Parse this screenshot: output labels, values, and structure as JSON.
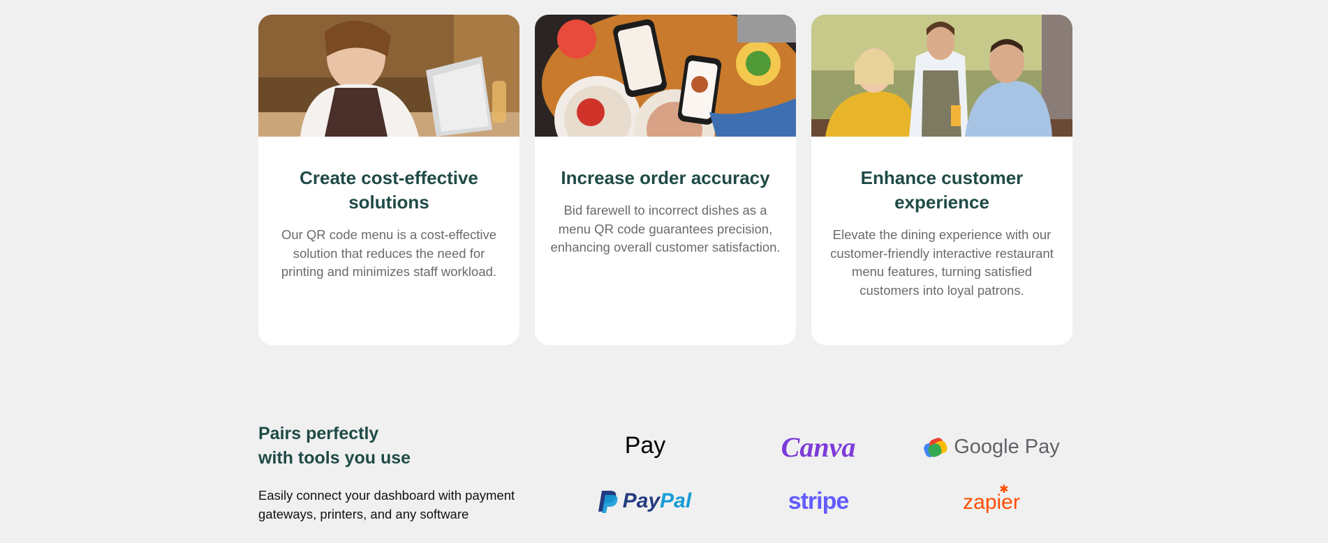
{
  "cards": [
    {
      "title": "Create cost-effective solutions",
      "description": "Our QR code menu is a cost-effective solution that reduces the need for printing and minimizes staff workload."
    },
    {
      "title": "Increase order accuracy",
      "description": "Bid farewell to incorrect dishes as a menu QR code guarantees precision, enhancing overall customer satisfaction."
    },
    {
      "title": "Enhance customer experience",
      "description": "Elevate the dining experience with our customer-friendly interactive restaurant menu features, turning satisfied customers into loyal patrons."
    }
  ],
  "integrations": {
    "title_line1": "Pairs perfectly",
    "title_line2": "with tools you use",
    "description": "Easily connect your dashboard with payment gateways, printers, and any software",
    "logos": {
      "apple_pay": "Pay",
      "canva": "Canva",
      "google_pay": "Google Pay",
      "paypal_1": "Pay",
      "paypal_2": "Pal",
      "stripe": "stripe",
      "zapier": "zapier"
    }
  },
  "colors": {
    "heading": "#1f4a46",
    "body_text": "#6a6a6a",
    "background": "#f0f0f0",
    "card": "#ffffff"
  }
}
